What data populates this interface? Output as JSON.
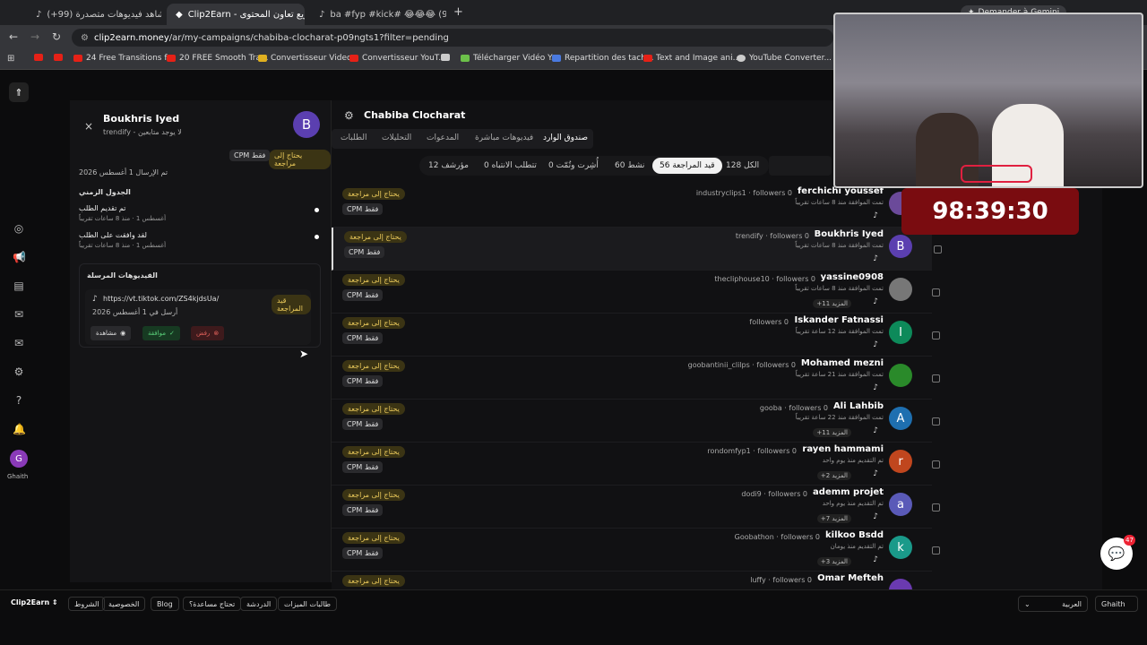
{
  "browser": {
    "tabs": [
      {
        "title": "شاهد فيديوهات متصدرة (99+)",
        "active": false
      },
      {
        "title": "Clip2Earn - تسريع تعاون المحتوى",
        "active": true
      },
      {
        "title": "ba #fyp #kick# 😂😂😂 (99+)",
        "active": false
      }
    ],
    "gemini": "Demander à Gemini",
    "url_host": "clip2earn.money",
    "url_path": "/ar/my-campaigns/chabiba-clocharat-p09ngts1?filter=pending",
    "bookmarks": [
      "24 Free Transitions f...",
      "20 FREE Smooth Tra...",
      "Convertisseur Video...",
      "Convertisseur YouT...",
      "Télécharger Vidéo Y...",
      "Repartition des tach...",
      "Text and Image ani...",
      "YouTube Converter..."
    ]
  },
  "rail": {
    "user_initial": "G",
    "user_name": "Ghaith"
  },
  "panel": {
    "close": "×",
    "name": "Boukhris Iyed",
    "subtitle": "trendify - لا يوجد متابعين",
    "initial": "B",
    "status_badge": "يحتاج إلى مراجعة",
    "cpm": "CPM فقط",
    "sent": "تم الإرسال 1 أغسطس 2026",
    "timeline_title": "الجدول الزمني",
    "timeline": [
      {
        "title": "تم تقديم الطلب",
        "time": "أغسطس 1 · منذ 8 ساعات تقريباً"
      },
      {
        "title": "لقد وافقت على الطلب",
        "time": "أغسطس 1 · منذ 8 ساعات تقريباً"
      }
    ],
    "videos_title": "الفيديوهات المرسلة",
    "video_url": "https://vt.tiktok.com/ZS4kjdsUa/",
    "video_badge": "قيد المراجعة",
    "video_date": "أرسل في 1 أغسطس 2026",
    "btn_view": "مشاهدة",
    "btn_approve": "موافقة",
    "btn_reject": "رفض"
  },
  "main": {
    "campaign": "Chabiba Clocharat",
    "tabs": [
      "صندوق الوارد",
      "فيديوهات مباشرة",
      "المدعوات",
      "التحليلات",
      "الطلبات"
    ],
    "filters": [
      "الكل 128",
      "قيد المراجعة 56",
      "نشط 60",
      "أُشِرت وتُمّت 0",
      "تتطلب الانتباه 0",
      "مؤرشف 12"
    ],
    "rows": [
      {
        "name": "ferchichi youssef",
        "meta": "industryclips1 · followers 0",
        "time": "تمت الموافقة منذ 8 ساعات تقريباً",
        "more": "",
        "initial": "",
        "color": "#6b4a9a"
      },
      {
        "name": "Boukhris Iyed",
        "meta": "trendify · followers 0",
        "time": "تمت الموافقة منذ 8 ساعات تقريباً",
        "more": "",
        "initial": "B",
        "color": "#5b3fb0"
      },
      {
        "name": "yassine0908",
        "meta": "thecliphouse10 · followers 0",
        "time": "تمت الموافقة منذ 8 ساعات تقريباً",
        "more": "+11 المزيد",
        "initial": "",
        "color": "#777"
      },
      {
        "name": "Iskander Fatnassi",
        "meta": "followers 0",
        "time": "تمت الموافقة منذ 12 ساعة تقريباً",
        "more": "",
        "initial": "I",
        "color": "#0d8a5a"
      },
      {
        "name": "Mohamed mezni",
        "meta": "goobantinii_clilps · followers 0",
        "time": "تمت الموافقة منذ 21 ساعة تقريباً",
        "more": "",
        "initial": "",
        "color": "#2a8a2a"
      },
      {
        "name": "Ali Lahbib",
        "meta": "gooba · followers 0",
        "time": "تمت الموافقة منذ 22 ساعة تقريباً",
        "more": "+11 المزيد",
        "initial": "A",
        "color": "#1e6fb0"
      },
      {
        "name": "rayen hammami",
        "meta": "rondomfyp1 · followers 0",
        "time": "تم التقديم منذ يوم واحد",
        "more": "+2 المزيد",
        "initial": "r",
        "color": "#c0461e"
      },
      {
        "name": "ademm projet",
        "meta": "dodi9 · followers 0",
        "time": "تم التقديم منذ يوم واحد",
        "more": "+7 المزيد",
        "initial": "a",
        "color": "#5a5ab8"
      },
      {
        "name": "kilkoo Bsdd",
        "meta": "Goobathon · followers 0",
        "time": "تم التقديم منذ يومان",
        "more": "+3 المزيد",
        "initial": "k",
        "color": "#1a9a8a"
      },
      {
        "name": "Omar Mefteh",
        "meta": "luffy · followers 0",
        "time": "",
        "more": "",
        "initial": "",
        "color": "#6a3ab0"
      }
    ],
    "row_badge": "يحتاج إلى مراجعة",
    "row_cpm": "CPM فقط",
    "tiktok": "♪"
  },
  "footer": {
    "brand": "Clip2Earn ⇕",
    "links": [
      "الشروط",
      "الخصوصية",
      "Blog",
      "تحتاج مساعدة؟",
      "الدردشة",
      "طالبات الميزات"
    ],
    "lang": "العربية",
    "user": "Ghaith"
  },
  "timer": "98:39:30",
  "chat_badge": "47"
}
